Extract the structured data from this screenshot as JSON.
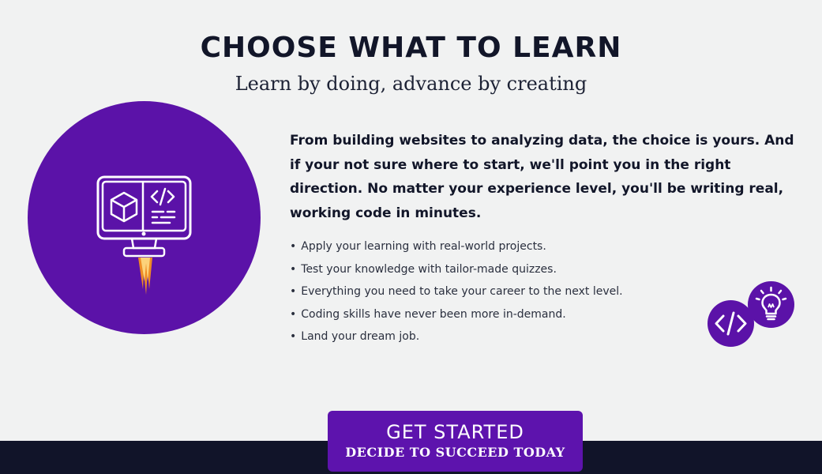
{
  "header": {
    "title": "CHOOSE WHAT TO LEARN",
    "subtitle": "Learn by doing, advance by creating"
  },
  "hero": {
    "icon": "rocket-computer-icon"
  },
  "intro": {
    "text": "From building websites to analyzing data, the choice is yours.  And if your not sure where to start, we'll point you in the right direction. No matter your experience level, you'll be writing real, working code in minutes."
  },
  "bullets": {
    "items": [
      {
        "text": "Apply your learning with real-world projects."
      },
      {
        "text": "Test your knowledge with tailor-made quizzes."
      },
      {
        "text": "Everything you need to take your career to the next level."
      },
      {
        "text": "Coding skills have never been more in-demand."
      },
      {
        "text": "Land your dream job."
      }
    ],
    "bullet_char": "•"
  },
  "badges": {
    "code_icon": "code-brackets-icon",
    "bulb_icon": "lightbulb-icon"
  },
  "cta": {
    "label": "GET STARTED",
    "sublabel": "DECIDE TO SUCCEED TODAY"
  },
  "colors": {
    "accent": "#5b12a8",
    "background": "#f1f2f2",
    "footer": "#111429",
    "heading": "#121629",
    "flame": "#f7941d"
  }
}
